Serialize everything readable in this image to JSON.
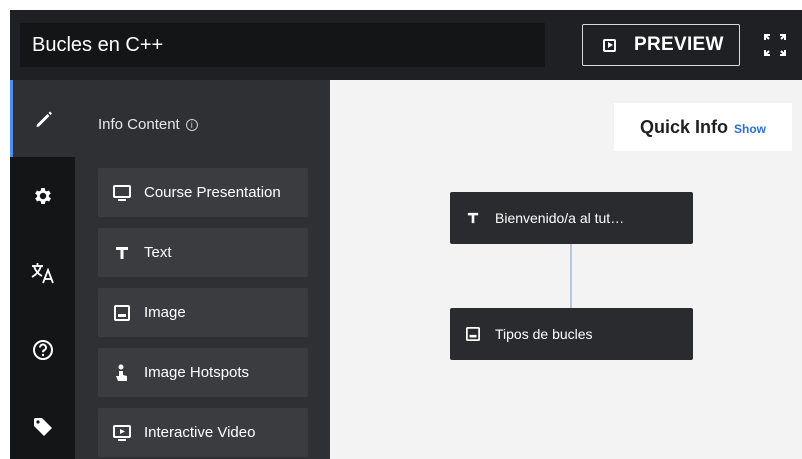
{
  "header": {
    "title_value": "Bucles en C++",
    "preview_label": "PREVIEW"
  },
  "rail": {
    "items": [
      {
        "icon": "pencil-icon",
        "active": true
      },
      {
        "icon": "gear-icon",
        "active": false
      },
      {
        "icon": "translate-icon",
        "active": false
      },
      {
        "icon": "help-icon",
        "active": false
      },
      {
        "icon": "tag-icon",
        "active": false
      }
    ]
  },
  "panel": {
    "heading": "Info Content",
    "info_glyph": "i",
    "content_types": [
      {
        "label": "Course Presentation",
        "icon": "monitor-icon"
      },
      {
        "label": "Text",
        "icon": "text-icon"
      },
      {
        "label": "Image",
        "icon": "image-icon"
      },
      {
        "label": "Image Hotspots",
        "icon": "hotspot-icon"
      },
      {
        "label": "Interactive Video",
        "icon": "video-icon"
      }
    ]
  },
  "canvas": {
    "quick_info_title": "Quick Info",
    "quick_info_toggle": "Show",
    "nodes": [
      {
        "label": "Bienvenido/a al tut…",
        "icon": "text-icon"
      },
      {
        "label": "Tipos de bucles",
        "icon": "image-icon"
      }
    ]
  },
  "colors": {
    "topbar": "#1f2023",
    "rail": "#141517",
    "panel": "#2e3033",
    "item": "#3a3c40",
    "canvas": "#f3f3f3",
    "accent": "#4a8ff0",
    "link": "#2b6fd6",
    "connector": "#b9c7dc"
  }
}
